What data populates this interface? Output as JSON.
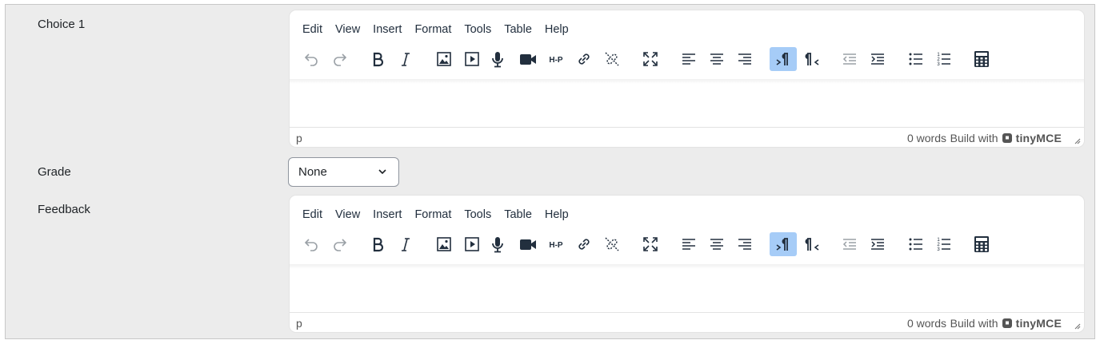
{
  "fields": {
    "choice_label": "Choice 1",
    "grade_label": "Grade",
    "feedback_label": "Feedback"
  },
  "grade_select": {
    "value": "None"
  },
  "editor": {
    "menus": [
      "Edit",
      "View",
      "Insert",
      "Format",
      "Tools",
      "Table",
      "Help"
    ],
    "toolbar_icons": [
      "undo-icon",
      "redo-icon",
      "bold-icon",
      "italic-icon",
      "image-icon",
      "media-icon",
      "record-audio-icon",
      "record-video-icon",
      "h5p-icon",
      "link-icon",
      "unlink-icon",
      "fullscreen-icon",
      "align-left-icon",
      "align-center-icon",
      "align-right-icon",
      "ltr-icon",
      "rtl-icon",
      "outdent-icon",
      "indent-icon",
      "bullet-list-icon",
      "numbered-list-icon",
      "equation-calculator-icon"
    ],
    "active_button": "ltr-icon",
    "status_path": "p",
    "word_count": "0 words",
    "build_with": "Build with",
    "brand": "tinyMCE"
  }
}
